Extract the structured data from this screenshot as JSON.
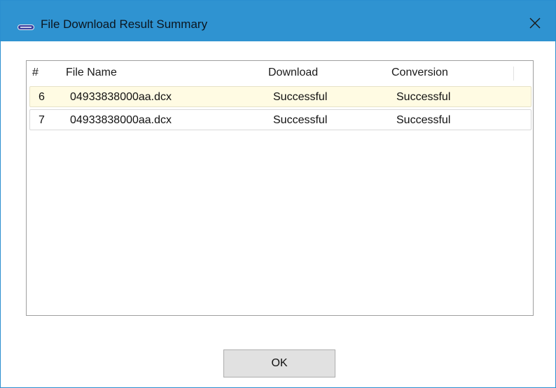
{
  "window": {
    "title": "File Download Result Summary",
    "icon": "app-dash-icon",
    "close_icon": "close-icon"
  },
  "table": {
    "columns": [
      "#",
      "File Name",
      "Download",
      "Conversion"
    ],
    "rows": [
      {
        "num": "6",
        "file_name": "04933838000aa.dcx",
        "download": "Successful",
        "conversion": "Successful",
        "selected": true
      },
      {
        "num": "7",
        "file_name": "04933838000aa.dcx",
        "download": "Successful",
        "conversion": "Successful",
        "selected": false
      }
    ]
  },
  "buttons": {
    "ok_label": "OK"
  },
  "colors": {
    "titlebar": "#2f93d1",
    "selected_row": "#fffbe3",
    "button_face": "#e1e1e1"
  }
}
